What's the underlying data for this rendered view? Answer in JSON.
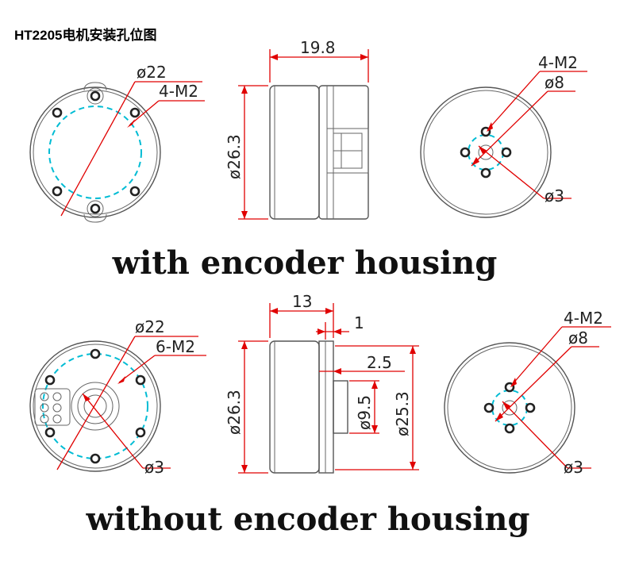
{
  "title": "HT2205电机安装孔位图",
  "sections": {
    "with_encoder": {
      "caption": "with encoder housing",
      "front_view": {
        "outer_diameter": "ø22",
        "holes": "4-M2"
      },
      "side_view": {
        "length": "19.8",
        "diameter": "ø26.3"
      },
      "rear_view": {
        "holes": "4-M2",
        "pcd": "ø8",
        "bore": "ø3"
      }
    },
    "without_encoder": {
      "caption": "without encoder housing",
      "front_view": {
        "outer_diameter": "ø22",
        "holes": "6-M2",
        "bore": "ø3"
      },
      "side_view": {
        "length": "13",
        "flange": "1",
        "boss": "2.5",
        "boss_diameter": "ø9.5",
        "diameter": "ø26.3",
        "rotor_diameter": "ø25.3"
      },
      "rear_view": {
        "holes": "4-M2",
        "pcd": "ø8",
        "bore": "ø3"
      }
    }
  },
  "colors": {
    "dimension": "#e00000",
    "pitch_circle": "#00bcd4",
    "outline": "#555555"
  }
}
